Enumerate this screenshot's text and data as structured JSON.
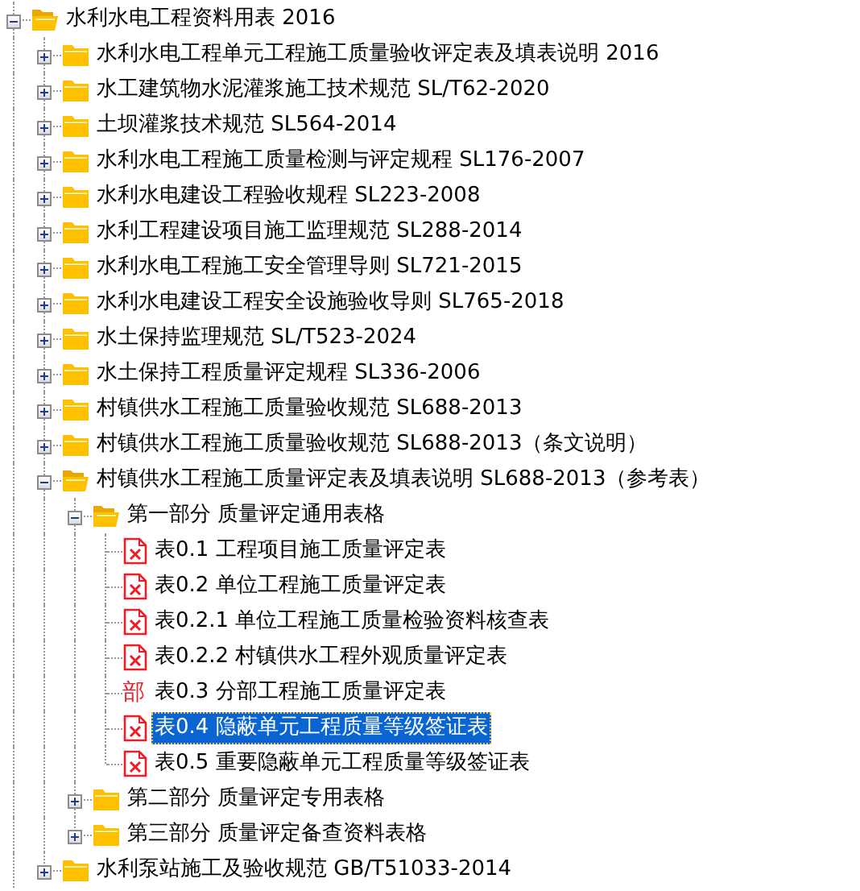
{
  "tree": {
    "items": [
      {
        "label": "水利水电工程资料用表 2016",
        "kind": "folder",
        "expanded": true,
        "selected": false,
        "children": [
          {
            "label": "水利水电工程单元工程施工质量验收评定表及填表说明 2016",
            "kind": "folder",
            "expanded": false,
            "selected": false
          },
          {
            "label": "水工建筑物水泥灌浆施工技术规范 SL/T62-2020",
            "kind": "folder",
            "expanded": false,
            "selected": false
          },
          {
            "label": "土坝灌浆技术规范 SL564-2014",
            "kind": "folder",
            "expanded": false,
            "selected": false
          },
          {
            "label": "水利水电工程施工质量检测与评定规程 SL176-2007",
            "kind": "folder",
            "expanded": false,
            "selected": false
          },
          {
            "label": "水利水电建设工程验收规程 SL223-2008",
            "kind": "folder",
            "expanded": false,
            "selected": false
          },
          {
            "label": "水利工程建设项目施工监理规范 SL288-2014",
            "kind": "folder",
            "expanded": false,
            "selected": false
          },
          {
            "label": "水利水电工程施工安全管理导则 SL721-2015",
            "kind": "folder",
            "expanded": false,
            "selected": false
          },
          {
            "label": "水利水电建设工程安全设施验收导则 SL765-2018",
            "kind": "folder",
            "expanded": false,
            "selected": false
          },
          {
            "label": "水土保持监理规范 SL/T523-2024",
            "kind": "folder",
            "expanded": false,
            "selected": false
          },
          {
            "label": "水土保持工程质量评定规程 SL336-2006",
            "kind": "folder",
            "expanded": false,
            "selected": false
          },
          {
            "label": "村镇供水工程施工质量验收规范 SL688-2013",
            "kind": "folder",
            "expanded": false,
            "selected": false
          },
          {
            "label": "村镇供水工程施工质量验收规范 SL688-2013（条文说明）",
            "kind": "folder",
            "expanded": false,
            "selected": false
          },
          {
            "label": "村镇供水工程施工质量评定表及填表说明 SL688-2013（参考表）",
            "kind": "folder",
            "expanded": true,
            "selected": false,
            "children": [
              {
                "label": "第一部分 质量评定通用表格",
                "kind": "folder",
                "expanded": true,
                "selected": false,
                "children": [
                  {
                    "label": "表0.1 工程项目施工质量评定表",
                    "kind": "sheet",
                    "selected": false
                  },
                  {
                    "label": "表0.2 单位工程施工质量评定表",
                    "kind": "sheet",
                    "selected": false
                  },
                  {
                    "label": "表0.2.1 单位工程施工质量检验资料核查表",
                    "kind": "sheet",
                    "selected": false
                  },
                  {
                    "label": "表0.2.2 村镇供水工程外观质量评定表",
                    "kind": "sheet",
                    "selected": false
                  },
                  {
                    "label": "表0.3 分部工程施工质量评定表",
                    "kind": "glyph",
                    "glyph": "部",
                    "selected": false
                  },
                  {
                    "label": "表0.4 隐蔽单元工程质量等级签证表",
                    "kind": "sheet",
                    "selected": true
                  },
                  {
                    "label": "表0.5 重要隐蔽单元工程质量等级签证表",
                    "kind": "sheet",
                    "selected": false
                  }
                ]
              },
              {
                "label": "第二部分 质量评定专用表格",
                "kind": "folder",
                "expanded": false,
                "selected": false
              },
              {
                "label": "第三部分 质量评定备查资料表格",
                "kind": "folder",
                "expanded": false,
                "selected": false
              }
            ]
          },
          {
            "label": "水利泵站施工及验收规范 GB/T51033-2014",
            "kind": "folder",
            "expanded": false,
            "selected": false
          }
        ]
      }
    ]
  }
}
